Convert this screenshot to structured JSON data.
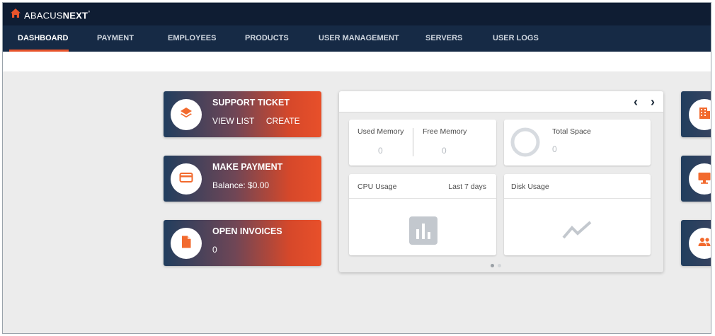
{
  "brand": {
    "logo_light": "ABACUS",
    "logo_bold": "NEXT",
    "logo_tm": "°"
  },
  "colors": {
    "navy": "#0f1d33",
    "nav": "#162a45",
    "accent": "#e8542b",
    "icon_orange": "#f26a2e"
  },
  "nav": {
    "items": [
      {
        "label": "DASHBOARD",
        "active": true
      },
      {
        "label": "PAYMENT"
      },
      {
        "label": "EMPLOYEES"
      },
      {
        "label": "PRODUCTS"
      },
      {
        "label": "USER MANAGEMENT"
      },
      {
        "label": "SERVERS"
      },
      {
        "label": "USER LOGS"
      }
    ]
  },
  "cards": {
    "support": {
      "title": "SUPPORT TICKET",
      "link_view": "VIEW LIST",
      "link_create": "CREATE",
      "icon": "layers-icon"
    },
    "payment": {
      "title": "MAKE PAYMENT",
      "balance": "Balance: $0.00",
      "icon": "credit-card-icon"
    },
    "invoices": {
      "title": "OPEN INVOICES",
      "count": "0",
      "icon": "document-icon"
    }
  },
  "widget": {
    "prev": "‹",
    "next": "›",
    "memory": {
      "used_label": "Used Memory",
      "used_value": "0",
      "free_label": "Free Memory",
      "free_value": "0"
    },
    "space": {
      "label": "Total Space",
      "value": "0"
    },
    "cpu": {
      "label": "CPU Usage",
      "range": "Last 7 days",
      "icon": "bar-chart-icon"
    },
    "disk": {
      "label": "Disk Usage",
      "icon": "trend-line-icon"
    },
    "pagination": {
      "pages": 2,
      "current": 1
    }
  },
  "right_cards": [
    {
      "icon": "building-icon"
    },
    {
      "icon": "monitor-icon"
    },
    {
      "icon": "users-icon"
    }
  ]
}
